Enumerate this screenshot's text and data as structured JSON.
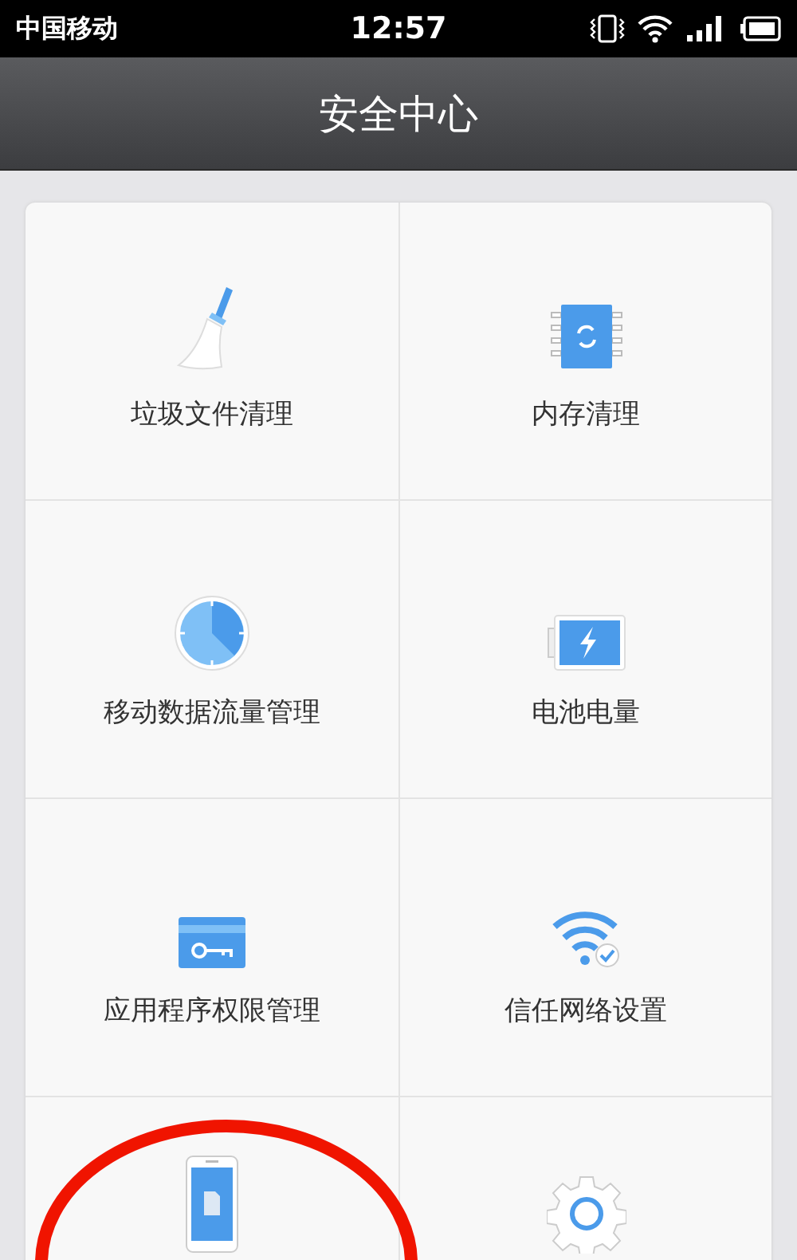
{
  "status_bar": {
    "carrier": "中国移动",
    "time": "12:57"
  },
  "header": {
    "title": "安全中心"
  },
  "tiles": [
    {
      "label": "垃圾文件清理"
    },
    {
      "label": "内存清理"
    },
    {
      "label": "移动数据流量管理"
    },
    {
      "label": "电池电量"
    },
    {
      "label": "应用程序权限管理"
    },
    {
      "label": "信任网络设置"
    }
  ]
}
